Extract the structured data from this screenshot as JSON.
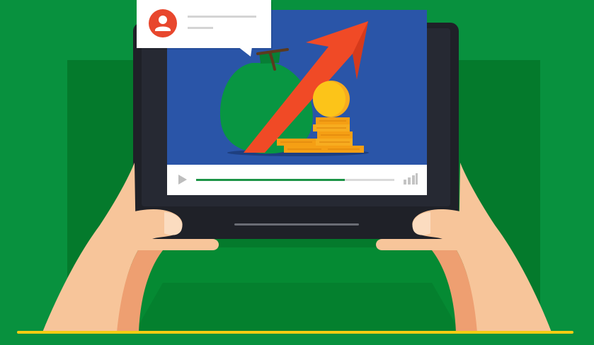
{
  "scene": {
    "description_icons": [
      "user-avatar-icon",
      "play-icon",
      "signal-bars-icon",
      "money-bag-icon",
      "growth-arrow-icon",
      "gold-coin-icon",
      "coin-stack-icon"
    ],
    "colors": {
      "background": "#08913e",
      "backdrop_dark_green": "#047a2c",
      "floor_green": "#05832f",
      "tablet_frame": "#1f2128",
      "screen_blue": "#2a55a8",
      "arrow_red": "#f04a26",
      "coin_gold": "#fcc419",
      "coin_orange": "#f59f14",
      "money_bag": "#089642",
      "notification_avatar": "#e8472d",
      "progress_fill": "#1d9447",
      "progress_track": "#dadada",
      "skin": "#f7c59a",
      "skin_shadow": "#ee9f71",
      "baseline_yellow": "#f8cc12"
    },
    "video": {
      "progress_fraction": 0.75
    }
  }
}
